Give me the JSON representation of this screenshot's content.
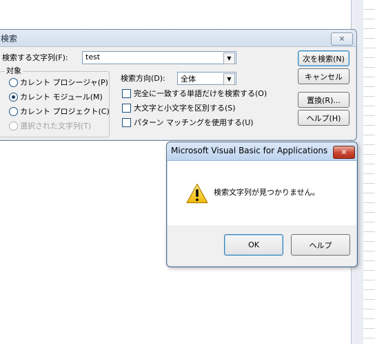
{
  "find_dialog": {
    "title": "検索",
    "close_glyph": "✕",
    "find_what_label": "検索する文字列(F):",
    "find_what_value": "test",
    "scope_label": "対象",
    "scope_options": [
      {
        "label": "カレント プロシージャ(P)",
        "checked": false,
        "disabled": false
      },
      {
        "label": "カレント モジュール(M)",
        "checked": true,
        "disabled": false
      },
      {
        "label": "カレント プロジェクト(C)",
        "checked": false,
        "disabled": false
      },
      {
        "label": "選択された文字列(T)",
        "checked": false,
        "disabled": true
      }
    ],
    "direction_label": "検索方向(D):",
    "direction_value": "全体",
    "options": [
      {
        "label": "完全に一致する単語だけを検索する(O)",
        "checked": false
      },
      {
        "label": "大文字と小文字を区別する(S)",
        "checked": false
      },
      {
        "label": "パターン マッチングを使用する(U)",
        "checked": false
      }
    ],
    "buttons": {
      "find_next": "次を検索(N)",
      "cancel": "キャンセル",
      "replace": "置換(R)...",
      "help": "ヘルプ(H)"
    }
  },
  "message_box": {
    "title": "Microsoft Visual Basic for Applications",
    "close_glyph": "✕",
    "icon": "warning-icon",
    "message": "検索文字列が見つかりません。",
    "buttons": {
      "ok": "OK",
      "help": "ヘルプ"
    }
  },
  "colors": {
    "active_close": "#c74430",
    "title_active": "#bdd3ee",
    "dialog_bg": "#f0f0f0",
    "warning_yellow": "#f7d21a"
  }
}
